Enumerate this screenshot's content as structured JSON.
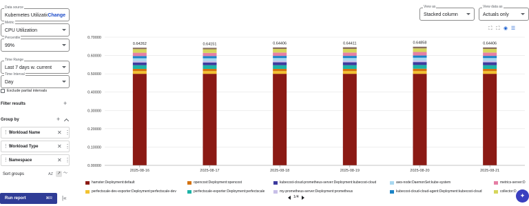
{
  "left_panel": {
    "data_source": {
      "label": "Data source",
      "value": "Kubernetes Utilization",
      "change_label": "Change"
    },
    "metric": {
      "label": "Metric",
      "value": "CPU Utilization"
    },
    "percentile": {
      "label": "Percentile",
      "value": "99%"
    },
    "time_range": {
      "label": "Time Range",
      "value": "Last 7 days w. current"
    },
    "time_interval": {
      "label": "Time Interval",
      "value": "Day"
    },
    "exclude_partial": {
      "label": "Exclude partial intervals",
      "checked": false
    },
    "filter_results_label": "Filter results",
    "group_by_label": "Group by",
    "group_by_items": [
      {
        "label": "Workload Name"
      },
      {
        "label": "Workload Type"
      },
      {
        "label": "Namespace"
      }
    ],
    "sort_groups_label": "Sort groups",
    "sort_az_label": "AZ",
    "run_report": {
      "label": "Run report",
      "shortcut": "⌘R"
    }
  },
  "view_as": {
    "label": "View as",
    "value": "Stacked column"
  },
  "view_data_as": {
    "label": "View data as",
    "value": "Actuals only"
  },
  "icons": {
    "crop1": "crop-icon",
    "crop2": "crop-alt-icon",
    "eye": "eye-icon",
    "menu": "menu-icon"
  },
  "pager": {
    "text": "1/4"
  },
  "chart_data": {
    "type": "bar",
    "stacked": true,
    "categories": [
      "2025-08-16",
      "2025-08-17",
      "2025-08-18",
      "2025-08-19",
      "2025-08-20",
      "2025-08-21"
    ],
    "totals_labels": [
      "0.64262",
      "0.64151",
      "0.64406",
      "0.64411",
      "0.64858",
      "0.64406"
    ],
    "yticks": [
      "0.00000",
      "0.10000",
      "0.20000",
      "0.30000",
      "0.40000",
      "0.50000",
      "0.60000",
      "0.70000"
    ],
    "ylim": [
      0,
      0.7
    ],
    "grid": true,
    "series": [
      {
        "name": "hamster:Deployment:default",
        "color": "#8b1a14",
        "values": [
          0.5,
          0.5,
          0.5,
          0.5,
          0.5,
          0.5
        ]
      },
      {
        "name": "perfectscale-dev-exporter:Deployment:perfectscale-dev",
        "color": "#f2c230",
        "values": [
          0.015,
          0.015,
          0.015,
          0.015,
          0.015,
          0.015
        ]
      },
      {
        "name": "opencost:Deployment:opencost",
        "color": "#d4720f",
        "values": [
          0.012,
          0.012,
          0.012,
          0.012,
          0.013,
          0.012
        ]
      },
      {
        "name": "perfectscale-exporter:Deployment:perfectscale",
        "color": "#1db3a6",
        "values": [
          0.02,
          0.02,
          0.02,
          0.02,
          0.02,
          0.02
        ]
      },
      {
        "name": "kubecost-cloud-prometheus-server:Deployment:kubecost-cloud",
        "color": "#3c3a9e",
        "values": [
          0.015,
          0.015,
          0.016,
          0.016,
          0.016,
          0.016
        ]
      },
      {
        "name": "my-prometheus-server:Deployment:prometheus",
        "color": "#c8bfe8",
        "values": [
          0.008,
          0.008,
          0.008,
          0.008,
          0.009,
          0.008
        ]
      },
      {
        "name": "aws-node:DaemonSet:kube-system",
        "color": "#a9d8f0",
        "values": [
          0.015,
          0.015,
          0.015,
          0.015,
          0.015,
          0.015
        ]
      },
      {
        "name": "kubecost-cloud-cloud-agent:Deployment:kubecost-cloud",
        "color": "#1a84c7",
        "values": [
          0.012,
          0.012,
          0.012,
          0.012,
          0.012,
          0.012
        ]
      },
      {
        "name": "metrics-server:D",
        "color": "#e57fa5",
        "values": [
          0.018,
          0.017,
          0.018,
          0.018,
          0.019,
          0.018
        ]
      },
      {
        "name": "collector:D",
        "color": "#d6d65c",
        "values": [
          0.02,
          0.02,
          0.02,
          0.02,
          0.02,
          0.02
        ]
      },
      {
        "name": "",
        "color": "#8b6f5e",
        "values": [
          0.008,
          0.008,
          0.008,
          0.009,
          0.009,
          0.008
        ]
      },
      {
        "name": "",
        "color": "#b8b8b8",
        "values": [
          0.00062,
          0.00051,
          0.00106,
          0.00111,
          0.00058,
          0.00106
        ]
      }
    ]
  }
}
